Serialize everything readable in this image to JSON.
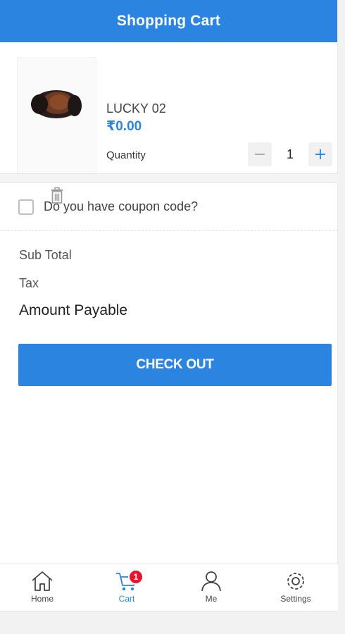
{
  "header": {
    "title": "Shopping Cart"
  },
  "cart_item": {
    "name": "LUCKY 02",
    "price": "₹0.00",
    "quantity_label": "Quantity",
    "quantity": "1",
    "minus_symbol": "−",
    "plus_symbol": "+"
  },
  "coupon": {
    "label": "Do you have coupon code?",
    "checked": false
  },
  "summary": {
    "sub_total_label": "Sub Total",
    "tax_label": "Tax",
    "amount_payable_label": "Amount Payable"
  },
  "checkout": {
    "label": "CHECK OUT"
  },
  "tabs": [
    {
      "label": "Home",
      "icon": "home-icon"
    },
    {
      "label": "Cart",
      "icon": "cart-icon",
      "badge": "1",
      "active": true
    },
    {
      "label": "Me",
      "icon": "user-icon"
    },
    {
      "label": "Settings",
      "icon": "gear-icon"
    }
  ],
  "colors": {
    "primary": "#2b85e0",
    "badge": "#e8132f"
  }
}
